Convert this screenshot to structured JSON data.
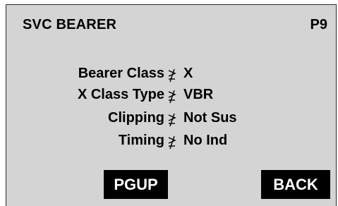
{
  "header": {
    "title": "SVC BEARER",
    "page": "P9"
  },
  "fields": [
    {
      "label": "Bearer Class",
      "value": "X"
    },
    {
      "label": "X Class Type",
      "value": "VBR"
    },
    {
      "label": "Clipping",
      "value": "Not Sus"
    },
    {
      "label": "Timing",
      "value": "No Ind"
    }
  ],
  "separator_icon": "gap-symbol-icon",
  "softkeys": {
    "pgup": "PGUP",
    "back": "BACK"
  },
  "colors": {
    "screen_bg": "#d4d4d4",
    "button_bg": "#000000",
    "button_text": "#ffffff",
    "text": "#000000"
  }
}
